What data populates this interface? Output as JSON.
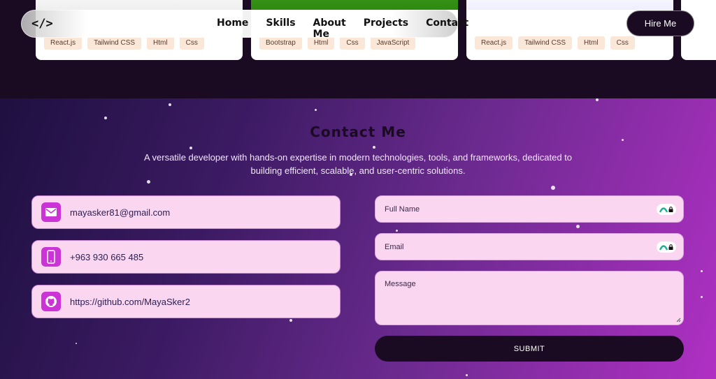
{
  "navbar": {
    "logo": "</>",
    "links": [
      "Home",
      "Skills",
      "About Me",
      "Projects",
      "Contact"
    ],
    "hire_label": "Hire Me"
  },
  "projects": [
    {
      "tags": [
        "React.js",
        "Tailwind CSS",
        "Html",
        "Css"
      ]
    },
    {
      "tags": [
        "Bootstrap",
        "Html",
        "Css",
        "JavaScript"
      ]
    },
    {
      "tags": [
        "React.js",
        "Tailwind CSS",
        "Html",
        "Css"
      ]
    }
  ],
  "contact": {
    "title": "Contact Me",
    "description": "A versatile developer with hands-on expertise in modern technologies, tools, and frameworks, dedicated to building efficient, scalable, and user-centric solutions.",
    "email": "mayasker81@gmail.com",
    "phone": "+963 930 665 485",
    "github": "https://github.com/MayaSker2"
  },
  "form": {
    "full_name_placeholder": "Full Name",
    "email_placeholder": "Email",
    "message_placeholder": "Message",
    "submit_label": "SUBMIT"
  },
  "icons": {
    "email": "mail-icon",
    "phone": "phone-icon",
    "github": "github-icon",
    "password_manager": "password-manager-icon"
  },
  "colors": {
    "dark": "#1b0b22",
    "accent": "#cc33d6",
    "field_bg": "#fad6f1",
    "tag_bg": "#fbe7d8"
  }
}
